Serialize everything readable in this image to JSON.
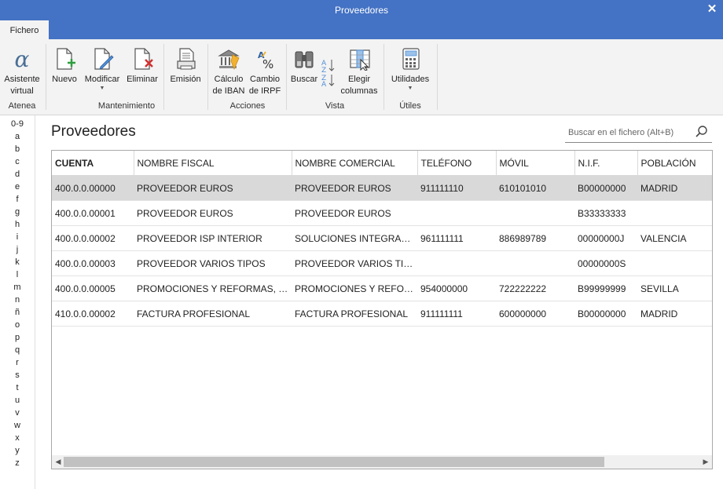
{
  "window": {
    "title": "Proveedores",
    "close": "✕"
  },
  "tabs": {
    "active": "Fichero"
  },
  "ribbon": {
    "atenea": {
      "label": "Atenea",
      "asistente": "Asistente\nvirtual"
    },
    "mantenimiento": {
      "label": "Mantenimiento",
      "nuevo": "Nuevo",
      "modificar": "Modificar",
      "eliminar": "Eliminar",
      "emision": "Emisión"
    },
    "acciones": {
      "label": "Acciones",
      "calculo_iban": "Cálculo\nde IBAN",
      "cambio_irpf": "Cambio\nde IRPF"
    },
    "vista": {
      "label": "Vista",
      "buscar": "Buscar",
      "elegir_columnas": "Elegir\ncolumnas"
    },
    "utiles": {
      "label": "Útiles",
      "utilidades": "Utilidades"
    }
  },
  "alphabet": [
    "0-9",
    "a",
    "b",
    "c",
    "d",
    "e",
    "f",
    "g",
    "h",
    "i",
    "j",
    "k",
    "l",
    "m",
    "n",
    "ñ",
    "o",
    "p",
    "q",
    "r",
    "s",
    "t",
    "u",
    "v",
    "w",
    "x",
    "y",
    "z"
  ],
  "page": {
    "title": "Proveedores"
  },
  "search": {
    "placeholder": "Buscar en el fichero (Alt+B)"
  },
  "table": {
    "columns": [
      "CUENTA",
      "NOMBRE FISCAL",
      "NOMBRE COMERCIAL",
      "TELÉFONO",
      "MÓVIL",
      "N.I.F.",
      "POBLACIÓN"
    ],
    "rows": [
      [
        "400.0.0.00000",
        "PROVEEDOR EUROS",
        "PROVEEDOR EUROS",
        "911111110",
        "610101010",
        "B00000000",
        "MADRID"
      ],
      [
        "400.0.0.00001",
        "PROVEEDOR EUROS",
        "PROVEEDOR EUROS",
        "",
        "",
        "B33333333",
        ""
      ],
      [
        "400.0.0.00002",
        "PROVEEDOR ISP INTERIOR",
        "SOLUCIONES INTEGRALES,...",
        "961111111",
        "886989789",
        "00000000J",
        "VALENCIA"
      ],
      [
        "400.0.0.00003",
        "PROVEEDOR VARIOS TIPOS",
        "PROVEEDOR VARIOS TIPOS",
        "",
        "",
        "00000000S",
        ""
      ],
      [
        "400.0.0.00005",
        "PROMOCIONES Y REFORMAS, S.L.",
        "PROMOCIONES Y REFORM...",
        "954000000",
        "722222222",
        "B99999999",
        "SEVILLA"
      ],
      [
        "410.0.0.00002",
        "FACTURA PROFESIONAL",
        "FACTURA PROFESIONAL",
        "911111111",
        "600000000",
        "B00000000",
        "MADRID"
      ]
    ],
    "selected_row": 0
  },
  "colors": {
    "titlebar": "#4472c4",
    "ribbon": "#f3f3f3",
    "selected_row": "#d9d9d9"
  }
}
